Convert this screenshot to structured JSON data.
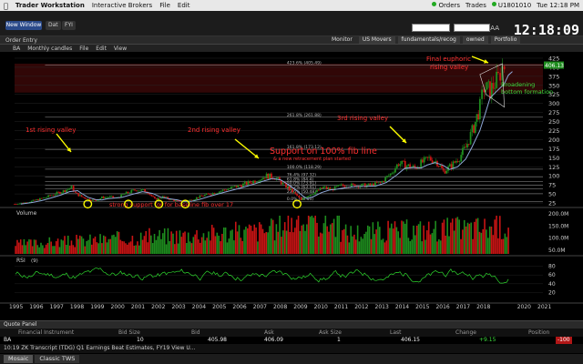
{
  "menubar": {
    "app_name": "Trader Workstation",
    "menus": [
      "Interactive Brokers",
      "File",
      "Edit"
    ],
    "right_items": [
      "Orders",
      "Trades",
      "U1801010",
      "Tue 12:18 PM"
    ]
  },
  "toolbar": {
    "new_window": "New Window",
    "small_btns": [
      "Dat",
      "FYI"
    ],
    "aa": "AA",
    "clock": "12:18:09",
    "order_entry": "Order Entry"
  },
  "window": {
    "tabs": [
      "Monitor",
      "US Movers",
      "fundamentals/recog",
      "owned",
      "Portfolio"
    ]
  },
  "chart_menu": {
    "symbol": "BA",
    "timeframe": "Monthly candles",
    "items": [
      "File",
      "Edit",
      "View"
    ]
  },
  "colors": {
    "up": "#1e8c1e",
    "down": "#c81414",
    "ma": "#8fa8d8",
    "annotation": "#ff3030",
    "highlight": "#ffff00"
  },
  "chart_data": {
    "type": "candlestick",
    "symbol": "BA",
    "x_range": [
      1995,
      2021
    ],
    "x_ticks": [
      "1995",
      "1996",
      "1997",
      "1998",
      "1999",
      "2000",
      "2001",
      "2002",
      "2003",
      "2004",
      "2005",
      "2006",
      "2007",
      "2008",
      "2009",
      "2010",
      "2011",
      "2012",
      "2013",
      "2014",
      "2015",
      "2016",
      "2017",
      "2018",
      "2020",
      "2021"
    ],
    "y_ticks": [
      425,
      400,
      375,
      350,
      325,
      300,
      275,
      250,
      225,
      200,
      175,
      150,
      125,
      100,
      75,
      50,
      25
    ],
    "ylim": [
      15,
      430
    ],
    "last_price_label": "406.13",
    "series_monthly_close": [
      [
        1995.0,
        22
      ],
      [
        1995.5,
        26
      ],
      [
        1996.0,
        32
      ],
      [
        1996.5,
        40
      ],
      [
        1997.0,
        50
      ],
      [
        1997.4,
        58
      ],
      [
        1997.8,
        68
      ],
      [
        1998.0,
        52
      ],
      [
        1998.3,
        42
      ],
      [
        1998.7,
        34
      ],
      [
        1999.0,
        32
      ],
      [
        1999.3,
        40
      ],
      [
        1999.7,
        42
      ],
      [
        2000.0,
        38
      ],
      [
        2000.5,
        52
      ],
      [
        2001.0,
        62
      ],
      [
        2001.5,
        58
      ],
      [
        2001.9,
        35
      ],
      [
        2002.3,
        42
      ],
      [
        2002.7,
        34
      ],
      [
        2003.0,
        30
      ],
      [
        2003.4,
        28
      ],
      [
        2003.8,
        36
      ],
      [
        2004.2,
        44
      ],
      [
        2004.6,
        50
      ],
      [
        2005.0,
        56
      ],
      [
        2005.5,
        64
      ],
      [
        2006.0,
        72
      ],
      [
        2006.5,
        80
      ],
      [
        2007.0,
        90
      ],
      [
        2007.4,
        100
      ],
      [
        2007.8,
        96
      ],
      [
        2008.2,
        78
      ],
      [
        2008.6,
        60
      ],
      [
        2008.9,
        45
      ],
      [
        2009.1,
        32
      ],
      [
        2009.4,
        45
      ],
      [
        2009.8,
        55
      ],
      [
        2010.2,
        68
      ],
      [
        2010.6,
        62
      ],
      [
        2011.0,
        72
      ],
      [
        2011.5,
        74
      ],
      [
        2012.0,
        73
      ],
      [
        2012.5,
        74
      ],
      [
        2013.0,
        80
      ],
      [
        2013.5,
        105
      ],
      [
        2013.9,
        135
      ],
      [
        2014.3,
        128
      ],
      [
        2014.7,
        122
      ],
      [
        2015.0,
        135
      ],
      [
        2015.4,
        148
      ],
      [
        2015.8,
        138
      ],
      [
        2016.1,
        112
      ],
      [
        2016.5,
        128
      ],
      [
        2016.9,
        152
      ],
      [
        2017.2,
        178
      ],
      [
        2017.6,
        235
      ],
      [
        2017.9,
        290
      ],
      [
        2018.1,
        345
      ],
      [
        2018.4,
        335
      ],
      [
        2018.8,
        370
      ],
      [
        2019.0,
        400
      ],
      [
        2019.2,
        406
      ]
    ],
    "fib_levels": [
      {
        "label": "423.6% (405.49)",
        "value": 405.5
      },
      {
        "label": "261.8% (261.88)",
        "value": 261.9
      },
      {
        "label": "161.8% (173.12)",
        "value": 173.1
      },
      {
        "label": "100.0% (118.29)",
        "value": 118.3
      },
      {
        "label": "76.4% (97.32)",
        "value": 97.3
      },
      {
        "label": "61.8% (84.4)",
        "value": 84.4
      },
      {
        "label": "50.0% (73.91)",
        "value": 73.9
      },
      {
        "label": "38.2% (63.41)",
        "value": 63.4
      },
      {
        "label": "23.6% (50.48)",
        "value": 50.5
      },
      {
        "label": "0.0% (29.53)",
        "value": 29.5
      }
    ],
    "annotations": {
      "first_valley": "1st rising valley",
      "second_valley": "2nd rising valley",
      "third_valley": "3rd rising valley",
      "final_valley": "Final euphoric rising valley",
      "broadening": "Broadening bottom formation",
      "support_fib": "Support on 100% fib line",
      "support_sub": "& a new retracement plan started",
      "baseline": "strong support for for baseline fib over 17",
      "yellow_circles_years": [
        1998.6,
        2000.6,
        2002.1,
        2003.4,
        2008.9
      ]
    },
    "volume": {
      "label": "Volume",
      "y_ticks": [
        "200.0M",
        "150.0M",
        "100.0M",
        "50.0M"
      ]
    },
    "rsi": {
      "label": "RSI",
      "period": "(9)",
      "y_ticks": [
        80,
        60,
        40,
        20
      ]
    }
  },
  "quote_panel": {
    "title": "Quote Panel",
    "headers": [
      "Financial Instrument",
      "Bid Size",
      "Bid",
      "Ask",
      "Ask Size",
      "Last",
      "Change",
      "Position"
    ],
    "row": {
      "symbol": "BA",
      "bid_size": "10",
      "bid": "405.98",
      "ask": "406.09",
      "ask_size": "1",
      "last": "406.15",
      "change": "+9.15",
      "position": "-100"
    },
    "news": "10:19 ZK Transcript (TDG) Q1 Earnings Beat Estimates, FY19 View U..."
  },
  "bottom_tabs": [
    "Mosaic",
    "Classic TWS"
  ]
}
